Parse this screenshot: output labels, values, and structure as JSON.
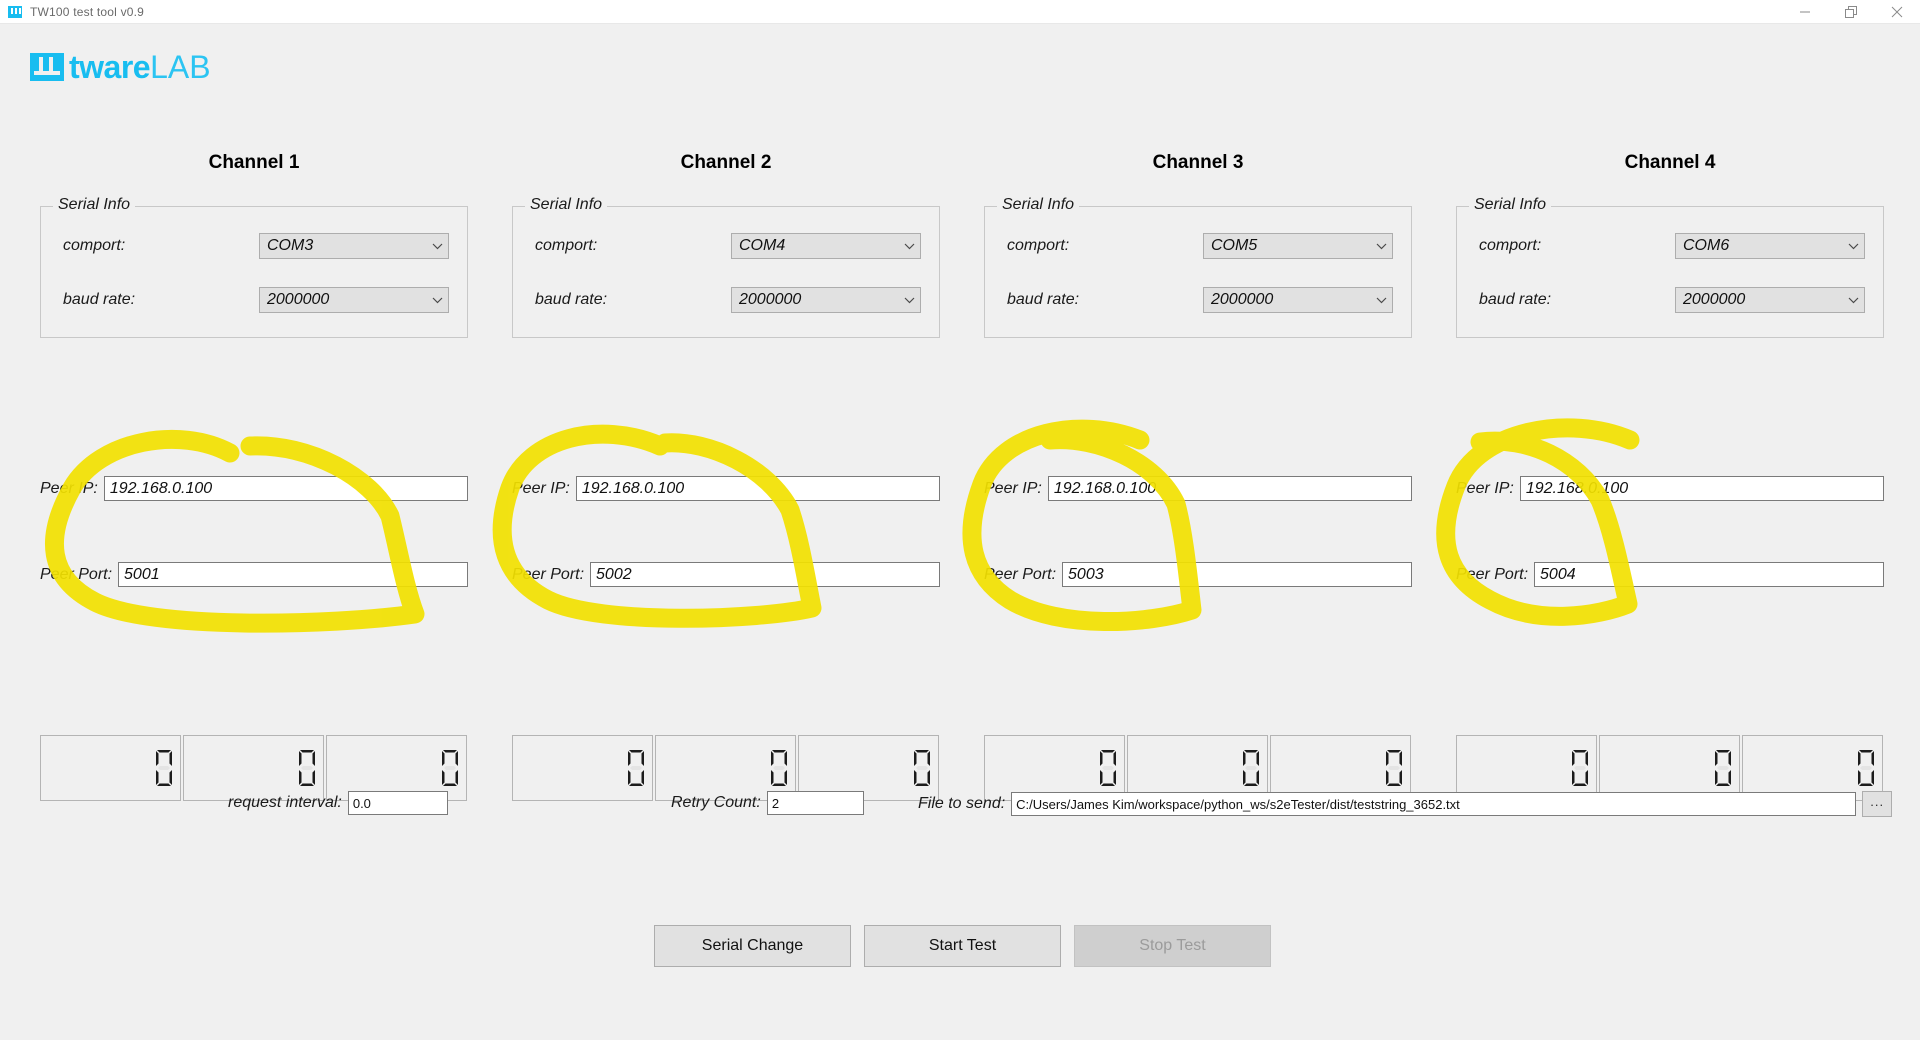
{
  "window": {
    "title": "TW100 test tool v0.9",
    "icon": "app-logo-icon",
    "controls": {
      "minimize": "minimize-icon",
      "restore": "restore-icon",
      "close": "close-icon"
    }
  },
  "brand": {
    "mark": "tware-logo-mark",
    "name_bold": "tware",
    "name_light": "LAB"
  },
  "labels": {
    "serial_info": "Serial Info",
    "comport": "comport:",
    "baud_rate": "baud rate:",
    "peer_ip": "Peer IP:",
    "peer_port": "Peer Port:"
  },
  "channels": [
    {
      "title": "Channel 1",
      "comport": "COM3",
      "baud_rate": "2000000",
      "peer_ip": "192.168.0.100",
      "peer_port": "5001",
      "counters": [
        "0",
        "0",
        "0"
      ]
    },
    {
      "title": "Channel 2",
      "comport": "COM4",
      "baud_rate": "2000000",
      "peer_ip": "192.168.0.100",
      "peer_port": "5002",
      "counters": [
        "0",
        "0",
        "0"
      ]
    },
    {
      "title": "Channel 3",
      "comport": "COM5",
      "baud_rate": "2000000",
      "peer_ip": "192.168.0.100",
      "peer_port": "5003",
      "counters": [
        "0",
        "0",
        "0"
      ]
    },
    {
      "title": "Channel 4",
      "comport": "COM6",
      "baud_rate": "2000000",
      "peer_ip": "192.168.0.100",
      "peer_port": "5004",
      "counters": [
        "0",
        "0",
        "0"
      ]
    }
  ],
  "bottom": {
    "request_interval_label": "request interval:",
    "request_interval_value": "0.0",
    "retry_count_label": "Retry Count:",
    "retry_count_value": "2",
    "file_to_send_label": "File to send:",
    "file_to_send_value": "C:/Users/James Kim/workspace/python_ws/s2eTester/dist/teststring_3652.txt",
    "browse_label": "..."
  },
  "actions": {
    "serial_change": "Serial Change",
    "start_test": "Start Test",
    "stop_test": "Stop Test"
  },
  "annotation": {
    "color": "#f5e400",
    "description": "yellow-highlighter-circles"
  }
}
